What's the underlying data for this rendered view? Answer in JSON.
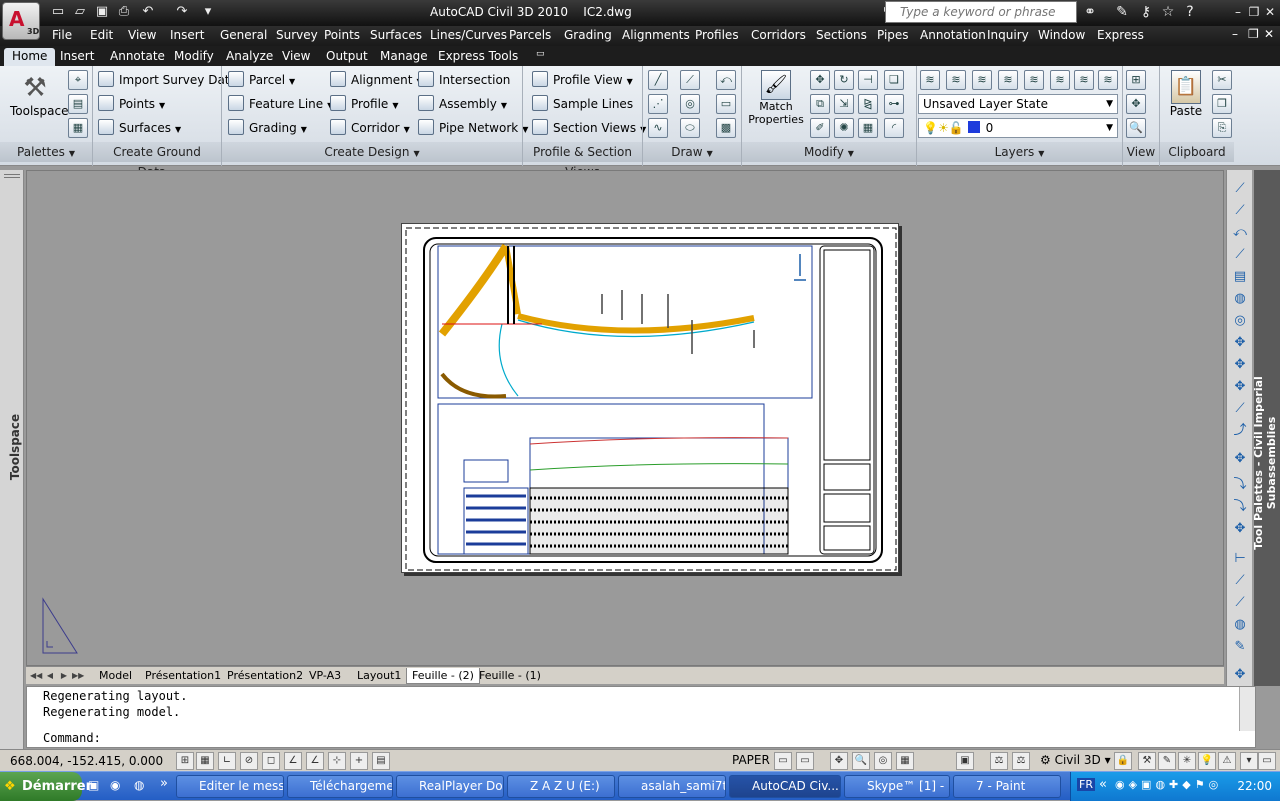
{
  "window": {
    "title": "AutoCAD Civil 3D 2010",
    "file": "IC2.dwg",
    "search_placeholder": "Type a keyword or phrase",
    "logo_text": "3D"
  },
  "menubar": [
    "File",
    "Edit",
    "View",
    "Insert",
    "General",
    "Survey",
    "Points",
    "Surfaces",
    "Lines/Curves",
    "Parcels",
    "Grading",
    "Alignments",
    "Profiles",
    "Corridors",
    "Sections",
    "Pipes",
    "Annotation",
    "Inquiry",
    "Window",
    "Express"
  ],
  "ribbon_tabs": [
    "Home",
    "Insert",
    "Annotate",
    "Modify",
    "Analyze",
    "View",
    "Output",
    "Manage",
    "Express Tools"
  ],
  "ribbon": {
    "palettes": {
      "toolspace": "Toolspace",
      "title": "Palettes"
    },
    "ground": {
      "import": "Import Survey Data",
      "points": "Points",
      "surfaces": "Surfaces",
      "title": "Create Ground Data"
    },
    "design": {
      "parcel": "Parcel",
      "feature_line": "Feature Line",
      "grading": "Grading",
      "alignment": "Alignment",
      "profile": "Profile",
      "corridor": "Corridor",
      "intersection": "Intersection",
      "assembly": "Assembly",
      "pipe_network": "Pipe Network",
      "title": "Create Design"
    },
    "profile_section": {
      "profile_view": "Profile View",
      "sample_lines": "Sample Lines",
      "section_views": "Section Views",
      "title": "Profile & Section Views"
    },
    "draw": {
      "title": "Draw"
    },
    "modify": {
      "match_line1": "Match",
      "match_line2": "Properties",
      "title": "Modify"
    },
    "layers": {
      "layer_state": "Unsaved Layer State",
      "layer": "0",
      "title": "Layers"
    },
    "view": {
      "title": "View"
    },
    "clipboard": {
      "paste": "Paste",
      "title": "Clipboard"
    }
  },
  "side": {
    "toolspace": "Toolspace",
    "palette": "Tool Palettes - Civil Imperial Subassemblies"
  },
  "layout_tabs": [
    "Model",
    "Présentation1",
    "Présentation2",
    "VP-A3",
    "Layout1",
    "Feuille - (2)",
    "Feuille - (1)"
  ],
  "active_layout_tab": "Feuille - (2)",
  "command": {
    "line1": "Regenerating layout.",
    "line2": "Regenerating model.",
    "prompt": "Command:"
  },
  "status": {
    "coords": "668.004, -152.415, 0.000",
    "paper": "PAPER",
    "workspace": "Civil 3D"
  },
  "taskbar": {
    "start": "Démarrer",
    "tasks": [
      "Editer le mess...",
      "Téléchargeme...",
      "RealPlayer Do...",
      "Z A Z U (E:)",
      "asalah_sami7t...",
      "AutoCAD Civ...",
      "Skype™ [1] - ...",
      "7 - Paint"
    ],
    "active_task": "AutoCAD Civ...",
    "lang": "FR",
    "clock": "22:00"
  },
  "colors": {
    "accent": "#1b5ea8",
    "canvas": "#9a9a9a",
    "taskbar": "#245ec5"
  }
}
